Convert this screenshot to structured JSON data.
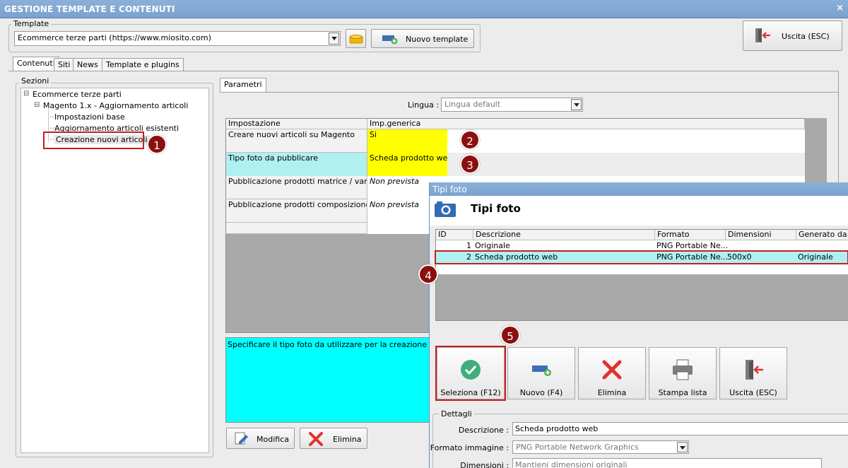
{
  "window": {
    "title": "GESTIONE TEMPLATE E CONTENUTI",
    "close_glyph": "×"
  },
  "template": {
    "group_label": "Template",
    "selected": "Ecommerce terze parti (https://www.miosito.com)",
    "new_template_label": "Nuovo template",
    "exit_label": "Uscita (ESC)"
  },
  "tabs": [
    "Contenuti",
    "Siti",
    "News",
    "Template e plugins"
  ],
  "sections": {
    "label": "Sezioni",
    "tree": {
      "root": "Ecommerce terze parti",
      "child": "Magento 1.x - Aggiornamento articoli",
      "leaves": [
        "Impostazioni base",
        "Aggiornamento articoli esistenti",
        "Creazione nuovi articoli"
      ]
    }
  },
  "params": {
    "tab_label": "Parametri",
    "lingua_label": "Lingua :",
    "lingua_value": "Lingua default",
    "columns": [
      "Impostazione",
      "Imp.generica"
    ],
    "rows": [
      {
        "setting": "Creare nuovi articoli su Magento",
        "value": "Si"
      },
      {
        "setting": "Tipo foto da pubblicare",
        "value": "Scheda prodotto web"
      },
      {
        "setting": "Pubblicazione prodotti matrice / varia...",
        "value": "Non prevista"
      },
      {
        "setting": "Pubblicazione prodotti composizione",
        "value": "Non prevista"
      }
    ],
    "description": "Specificare il tipo foto da utilizzare per la creazione di nuovi",
    "edit_label": "Modifica",
    "delete_label": "Elimina"
  },
  "dialog": {
    "title": "Tipi foto",
    "heading": "Tipi foto",
    "columns": [
      "ID",
      "Descrizione",
      "Formato",
      "Dimensioni",
      "Generato da..."
    ],
    "rows": [
      {
        "id": "1",
        "descrizione": "Originale",
        "formato": "PNG Portable Ne...",
        "dimensioni": "",
        "generato": ""
      },
      {
        "id": "2",
        "descrizione": "Scheda prodotto web",
        "formato": "PNG Portable Ne...",
        "dimensioni": "500x0",
        "generato": "Originale"
      }
    ],
    "buttons": {
      "select": "Seleziona (F12)",
      "new": "Nuovo (F4)",
      "delete": "Elimina",
      "print": "Stampa lista",
      "exit": "Uscita (ESC)"
    },
    "details": {
      "label": "Dettagli",
      "descrizione_label": "Descrizione :",
      "descrizione_value": "Scheda prodotto web",
      "formato_label": "Formato immagine :",
      "formato_value": "PNG Portable Network Graphics",
      "dimensioni_label": "Dimensioni :",
      "dimensioni_value": "Mantieni dimensioni originali"
    }
  },
  "markers": [
    "1",
    "2",
    "3",
    "4",
    "5"
  ],
  "colors": {
    "highlight_yellow": "#ffff00",
    "highlight_cyan": "#b0f0f0",
    "description_cyan": "#00ffff",
    "marker_red": "#8a1010",
    "annotation_red": "#c81e1e"
  }
}
